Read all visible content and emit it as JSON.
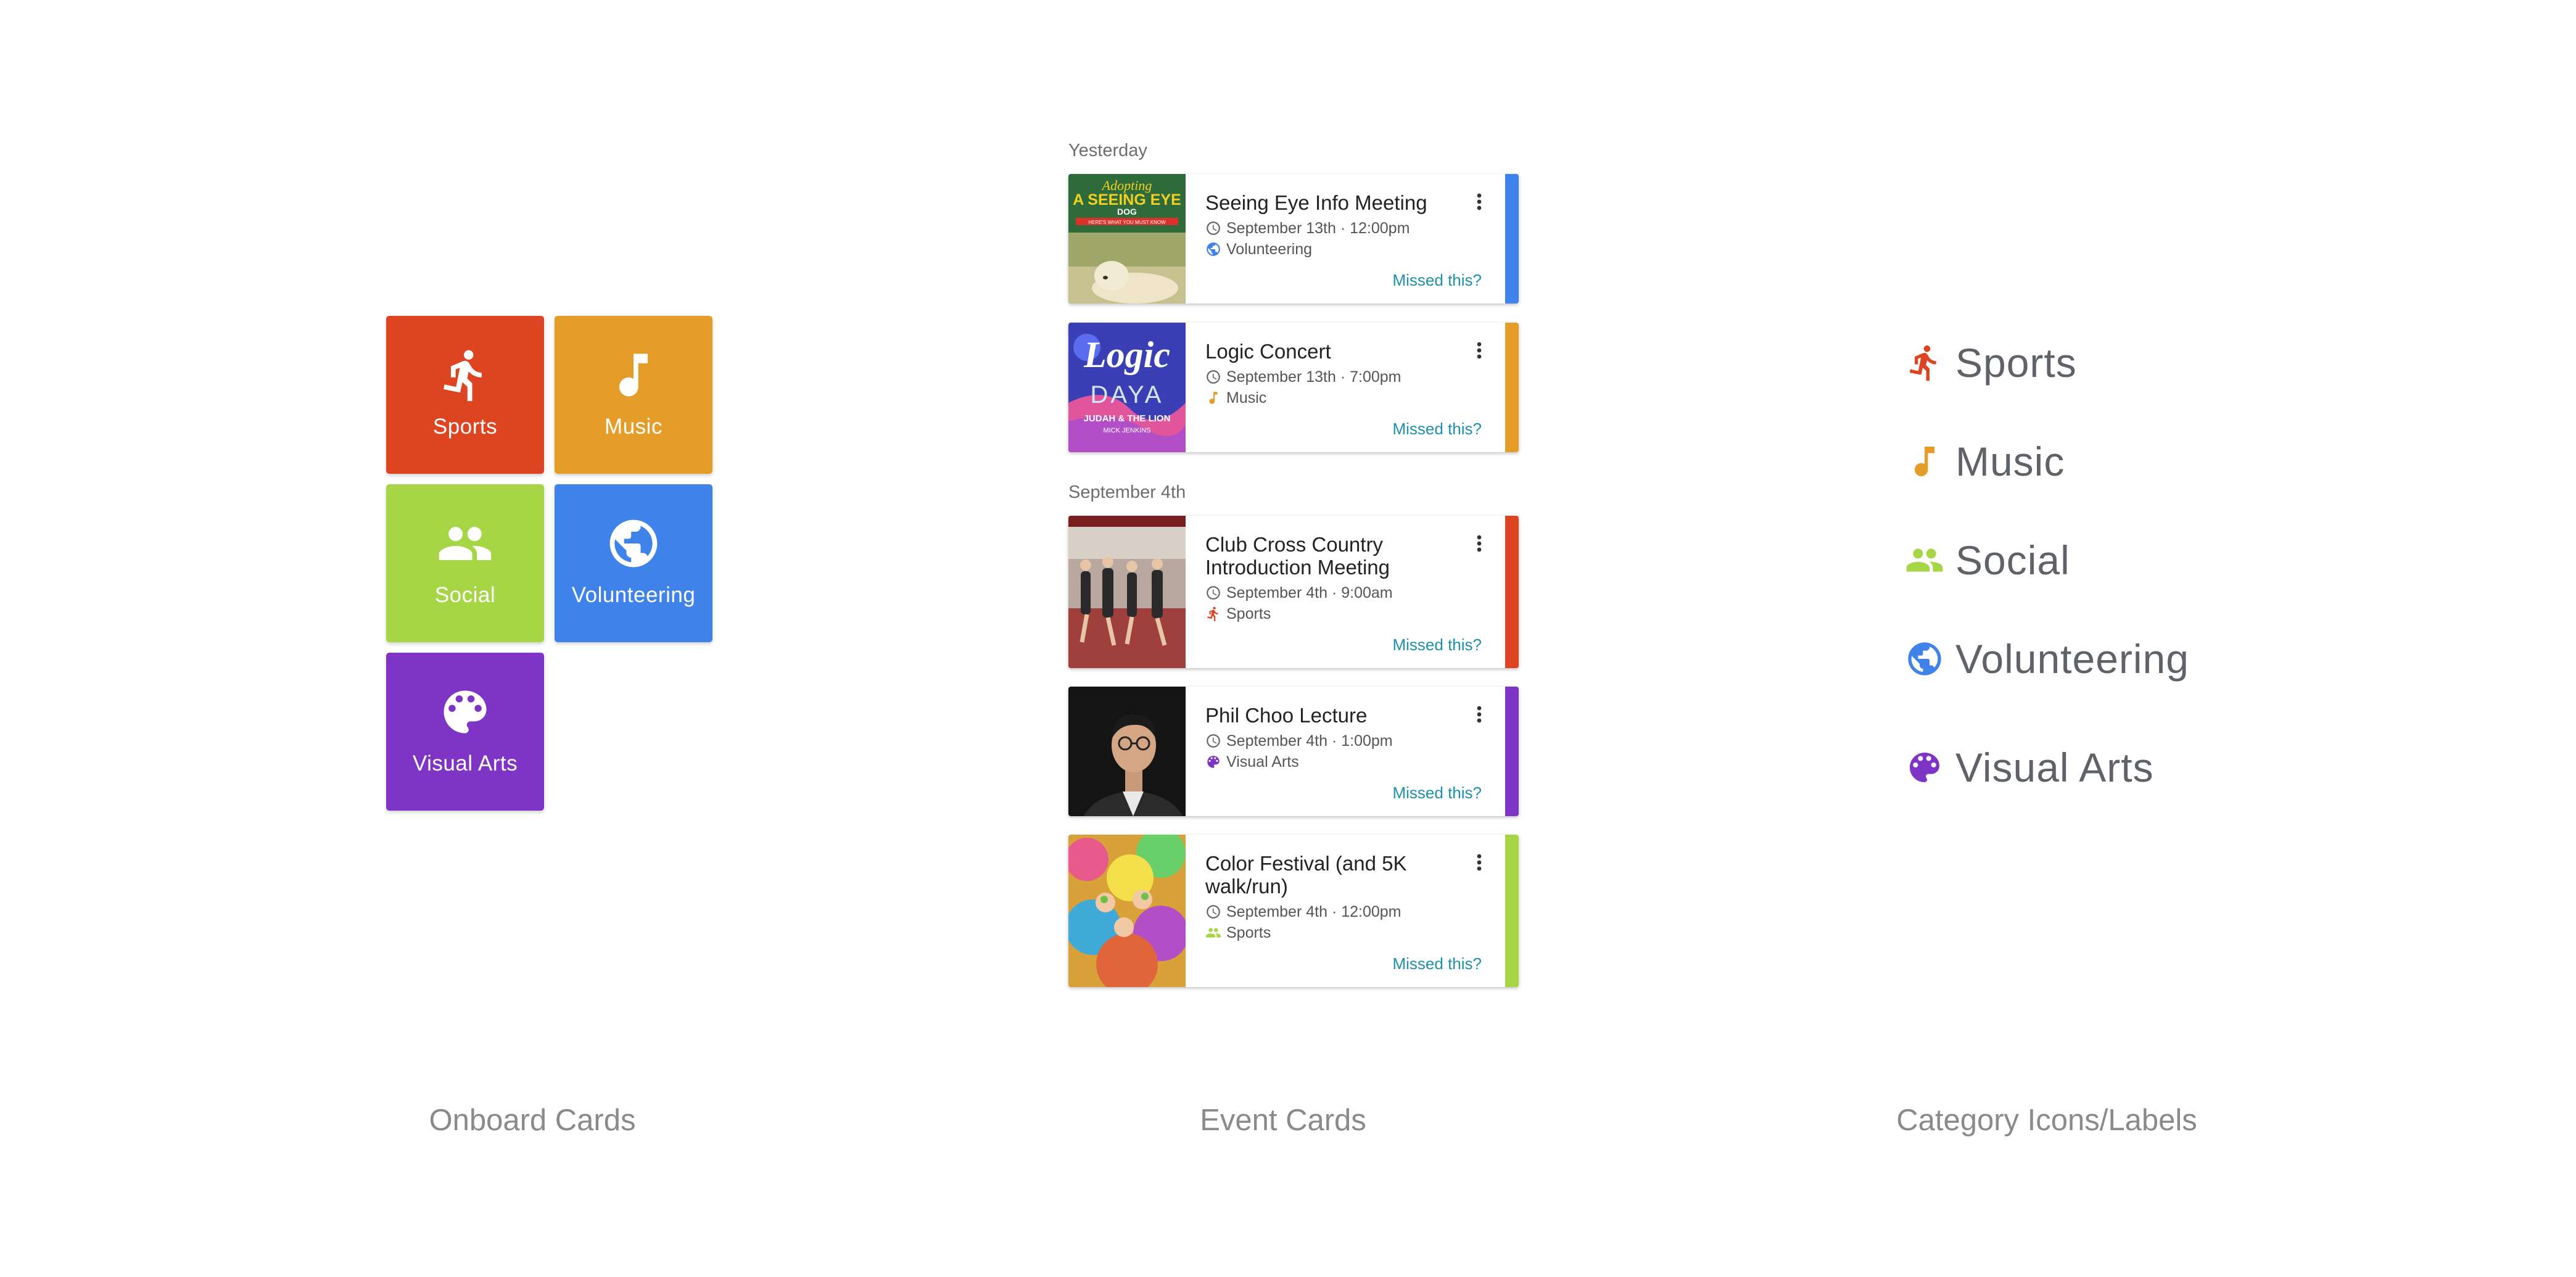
{
  "colors": {
    "sports": "#DD4422",
    "music": "#E59D2A",
    "social": "#A6D645",
    "volunteering": "#3F82EA",
    "visual_arts": "#7E35C6",
    "link": "#1E8FAE"
  },
  "onboard": {
    "caption": "Onboard Cards",
    "tiles": [
      {
        "label": "Sports",
        "icon": "run-icon"
      },
      {
        "label": "Music",
        "icon": "music-note-icon"
      },
      {
        "label": "Social",
        "icon": "people-icon"
      },
      {
        "label": "Volunteering",
        "icon": "globe-icon"
      },
      {
        "label": "Visual Arts",
        "icon": "palette-icon"
      }
    ]
  },
  "events": {
    "caption": "Event Cards",
    "groups": [
      {
        "label": "Yesterday",
        "cards": [
          {
            "title": "Seeing Eye Info Meeting",
            "date": "September 13th",
            "time": "12:00pm",
            "category": "Volunteering",
            "category_icon": "globe-icon",
            "missed": "Missed this?",
            "thumb_text": [
              "Adopting",
              "A SEEING EYE",
              "DOG",
              "HERE'S WHAT YOU MUST KNOW"
            ]
          },
          {
            "title": "Logic Concert",
            "date": "September 13th",
            "time": "7:00pm",
            "category": "Music",
            "category_icon": "music-note-icon",
            "missed": "Missed this?",
            "thumb_text": [
              "Logic",
              "DAYA",
              "JUDAH & THE LION",
              "MICK JENKINS"
            ]
          }
        ]
      },
      {
        "label": "September 4th",
        "cards": [
          {
            "title_lines": [
              "Club Cross Country",
              "Introduction Meeting"
            ],
            "date": "September 4th",
            "time": "9:00am",
            "category": "Sports",
            "category_icon": "run-icon",
            "missed": "Missed this?"
          },
          {
            "title": "Phil Choo Lecture",
            "date": "September 4th",
            "time": "1:00pm",
            "category": "Visual Arts",
            "category_icon": "palette-icon",
            "missed": "Missed this?"
          },
          {
            "title_lines": [
              "Color Festival (and 5K",
              "walk/run)"
            ],
            "date": "September 4th",
            "time": "12:00pm",
            "category": "Sports",
            "category_icon": "people-icon",
            "missed": "Missed this?"
          }
        ]
      }
    ]
  },
  "categories": {
    "caption": "Category Icons/Labels",
    "items": [
      {
        "label": "Sports",
        "icon": "run-icon"
      },
      {
        "label": "Music",
        "icon": "music-note-icon"
      },
      {
        "label": "Social",
        "icon": "people-icon"
      },
      {
        "label": "Volunteering",
        "icon": "globe-icon"
      },
      {
        "label": "Visual Arts",
        "icon": "palette-icon"
      }
    ]
  }
}
